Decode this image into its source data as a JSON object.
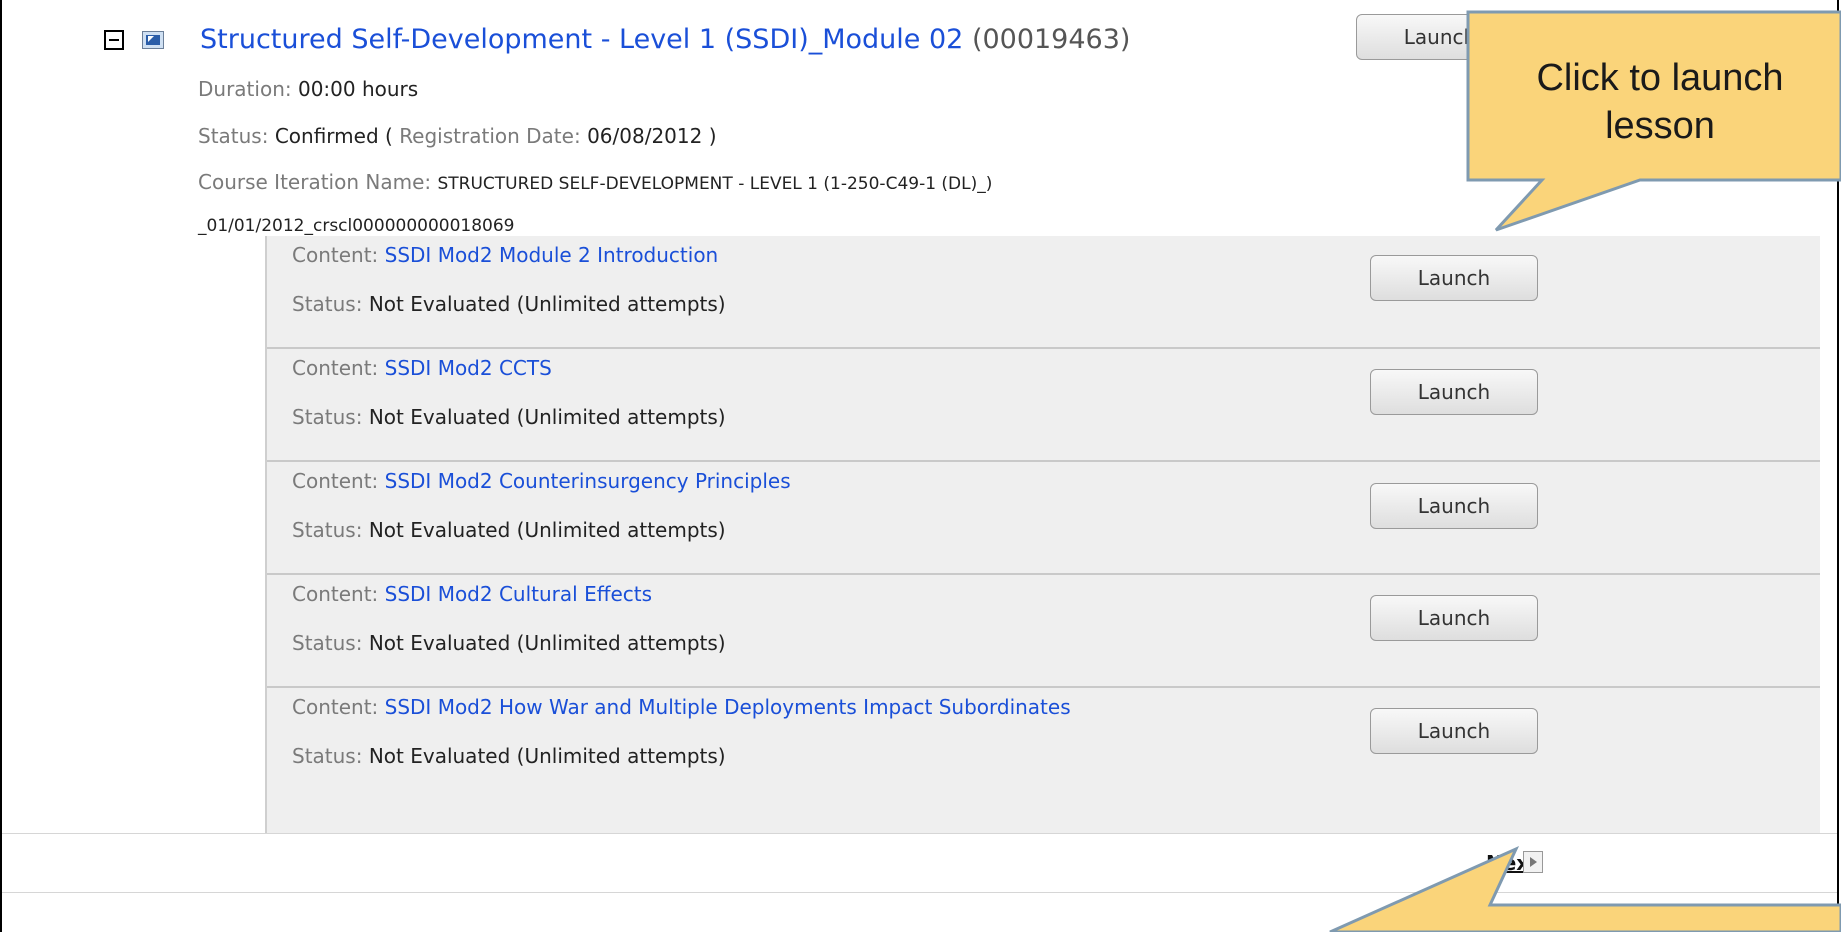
{
  "course": {
    "title": "Structured Self-Development - Level 1 (SSDI)_Module 02",
    "code": "(00019463)",
    "launch_label": "Launch",
    "duration_label": "Duration:",
    "duration_value": "00:00 hours",
    "status_label": "Status:",
    "status_value": "Confirmed",
    "status_open": "(",
    "registration_label": "Registration Date:",
    "registration_value": "06/08/2012",
    "status_close": ")",
    "iteration_label": "Course Iteration Name:",
    "iteration_value_line1": "STRUCTURED SELF-DEVELOPMENT - LEVEL 1 (1-250-C49-1 (DL)_)",
    "iteration_value_line2": "_01/01/2012_crscl000000000018069"
  },
  "contents": [
    {
      "label": "Content:",
      "name": "SSDI Mod2 Module 2 Introduction",
      "status_label": "Status:",
      "status_value": "Not Evaluated (Unlimited attempts)",
      "launch_label": "Launch"
    },
    {
      "label": "Content:",
      "name": "SSDI Mod2 CCTS",
      "status_label": "Status:",
      "status_value": "Not Evaluated (Unlimited attempts)",
      "launch_label": "Launch"
    },
    {
      "label": "Content:",
      "name": "SSDI Mod2 Counterinsurgency Principles",
      "status_label": "Status:",
      "status_value": "Not Evaluated (Unlimited attempts)",
      "launch_label": "Launch"
    },
    {
      "label": "Content:",
      "name": "SSDI Mod2 Cultural Effects",
      "status_label": "Status:",
      "status_value": "Not Evaluated (Unlimited attempts)",
      "launch_label": "Launch"
    },
    {
      "label": "Content:",
      "name": "SSDI Mod2 How War and Multiple Deployments Impact Subordinates",
      "status_label": "Status:",
      "status_value": "Not Evaluated (Unlimited attempts)",
      "launch_label": "Launch"
    }
  ],
  "pagination": {
    "next_label": "Next"
  },
  "callout": {
    "line1": "Click to launch",
    "line2": "lesson"
  },
  "colors": {
    "link": "#1a4fd8",
    "callout_fill": "#fad47a",
    "callout_border": "#7f9ab0"
  }
}
